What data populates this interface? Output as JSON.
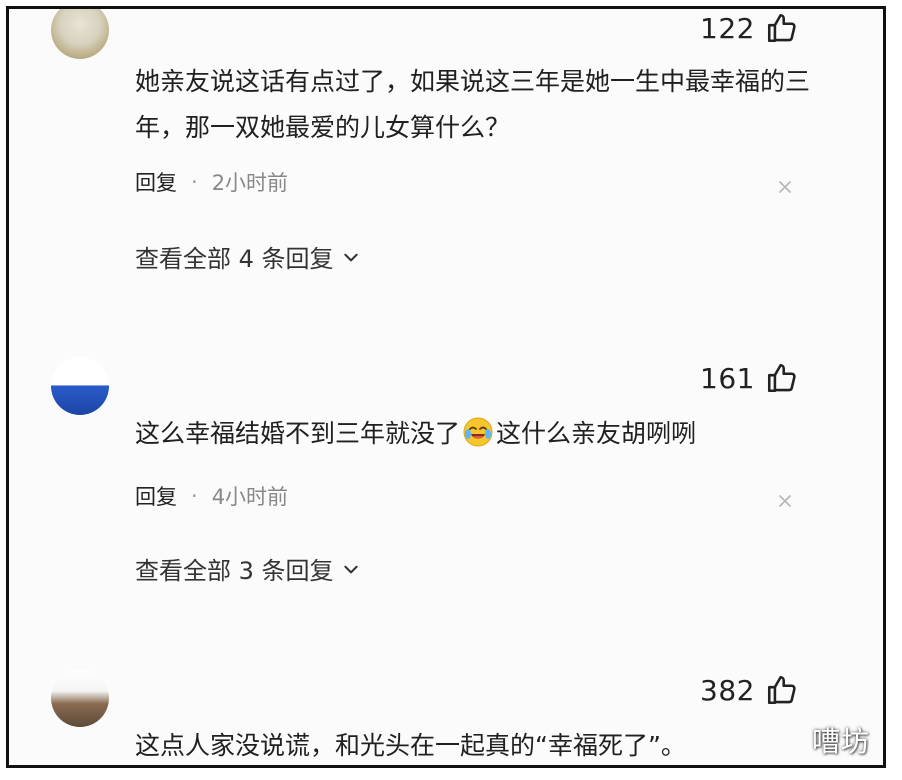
{
  "comments": [
    {
      "likes": "122",
      "text": "她亲友说这话有点过了，如果说这三年是她一生中最幸福的三年，那一双她最爱的儿女算什么？",
      "reply_label": "回复",
      "separator": "·",
      "time": "2小时前",
      "view_replies": "查看全部 4 条回复"
    },
    {
      "likes": "161",
      "text_before": "这么幸福结婚不到三年就没了",
      "emoji": "laughing-crying-emoji",
      "text_after": "这什么亲友胡咧咧",
      "reply_label": "回复",
      "separator": "·",
      "time": "4小时前",
      "view_replies": "查看全部 3 条回复"
    },
    {
      "likes": "382",
      "text": "这点人家没说谎，和光头在一起真的“幸福死了”。"
    }
  ],
  "watermark": "嘈坊",
  "colors": {
    "text": "#202020",
    "muted": "#888888",
    "frame": "#111111"
  }
}
